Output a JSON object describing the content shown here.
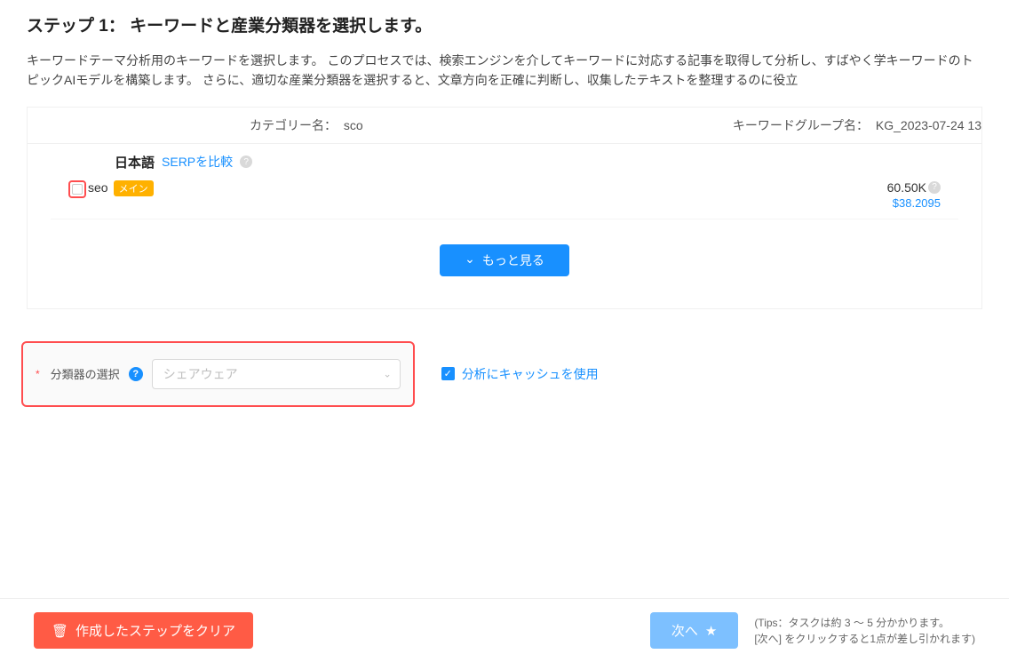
{
  "header": {
    "step_title": "ステップ 1： キーワードと産業分類器を選択します。",
    "step_desc": "キーワードテーマ分析用のキーワードを選択します。 このプロセスでは、検索エンジンを介してキーワードに対応する記事を取得して分析し、すばやく学キーワードのトピックAIモデルを構築します。 さらに、適切な産業分類器を選択すると、文章方向を正確に判断し、収集したテキストを整理するのに役立"
  },
  "card": {
    "category_label": "カテゴリー名：",
    "category_value": "sco",
    "kg_label": "キーワードグループ名：",
    "kg_value": "KG_2023-07-24 13",
    "language": "日本語",
    "compare_serp": "SERPを比較",
    "keyword": {
      "name": "seo",
      "badge": "メイン",
      "volume": "60.50K",
      "cpc": "$38.2095"
    },
    "see_more_label": "もっと見る"
  },
  "classifier": {
    "label": "分類器の選択",
    "placeholder": "シェアウェア"
  },
  "cache": {
    "label": "分析にキャッシュを使用"
  },
  "footer": {
    "clear_label": "作成したステップをクリア",
    "next_label": "次へ",
    "tips_line1": "(Tips：タスクは約 3 ～ 5 分かかります。",
    "tips_line2": "[次へ] をクリックすると1点が差し引かれます)"
  },
  "icons": {
    "help": "?",
    "check": "✓",
    "chevron_down": "⌄",
    "select_arrow": "⌄",
    "star": "★",
    "trash": "🗑"
  }
}
